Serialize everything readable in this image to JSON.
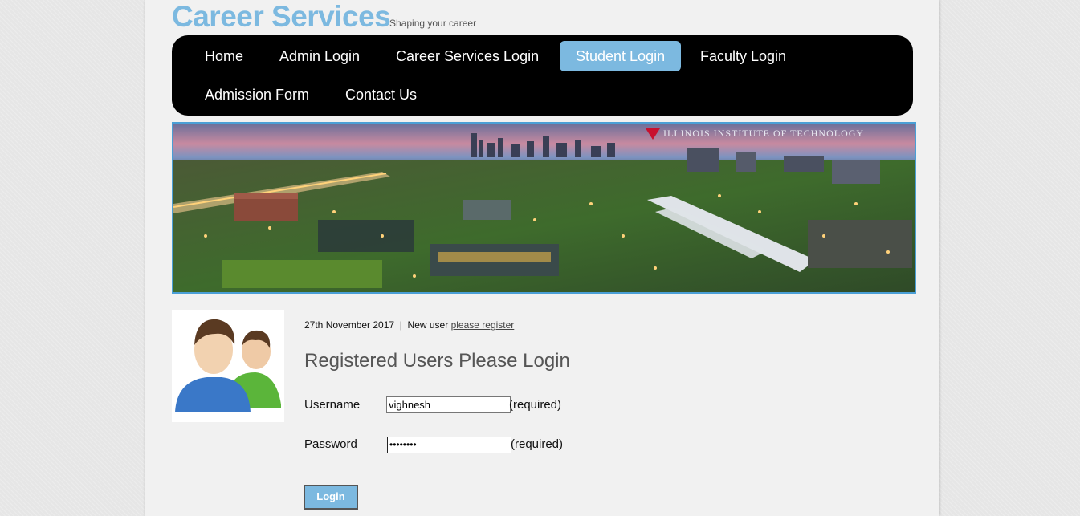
{
  "header": {
    "site_title": "Career Services",
    "tagline": "Shaping your career"
  },
  "nav": {
    "items": [
      {
        "label": "Home",
        "active": false
      },
      {
        "label": "Admin Login",
        "active": false
      },
      {
        "label": "Career Services Login",
        "active": false
      },
      {
        "label": "Student Login",
        "active": true
      },
      {
        "label": "Faculty Login",
        "active": false
      },
      {
        "label": "Admission Form",
        "active": false
      },
      {
        "label": "Contact Us",
        "active": false
      }
    ]
  },
  "banner": {
    "caption": "ILLINOIS INSTITUTE OF TECHNOLOGY"
  },
  "meta": {
    "date": "27th November 2017",
    "separator": "|",
    "new_user_text": "New user",
    "register_link": "please register"
  },
  "login": {
    "heading": "Registered Users Please Login",
    "username_label": "Username",
    "username_value": "vighnesh",
    "password_label": "Password",
    "password_value": "••••••••",
    "required_text": "(required)",
    "button_label": "Login"
  },
  "colors": {
    "accent": "#7cb9e0",
    "nav_bg": "#000000",
    "banner_border": "#4a9fd6"
  }
}
